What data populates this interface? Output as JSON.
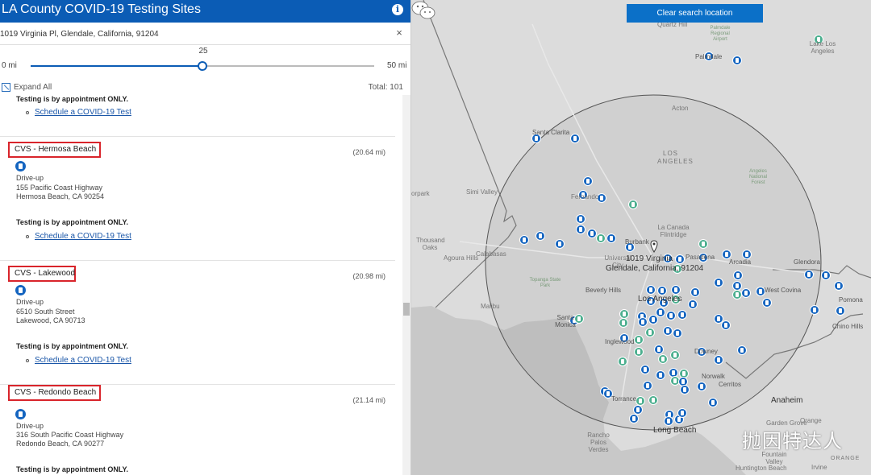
{
  "header": {
    "title": "LA County COVID-19 Testing Sites",
    "info_icon": "i"
  },
  "search": {
    "value": "1019 Virginia Pl, Glendale, California, 91204",
    "clear_icon": "×"
  },
  "radius_slider": {
    "value": "25",
    "min_label": "0 mi",
    "max_label": "50 mi",
    "fraction": 0.5
  },
  "list_controls": {
    "expand_label": "Expand All",
    "total_label": "Total: 101"
  },
  "results": {
    "top_fragment": {
      "note": "Testing is by appointment ONLY.",
      "link": "Schedule a COVID-19 Test"
    },
    "items": [
      {
        "name": "CVS - Hermosa Beach",
        "distance": "(20.64 mi)",
        "type": "Drive-up",
        "street": "155 Pacific Coast Highway",
        "city": "Hermosa Beach, CA 90254",
        "note": "Testing is by appointment ONLY.",
        "link": "Schedule a COVID-19 Test"
      },
      {
        "name": "CVS - Lakewood",
        "distance": "(20.98 mi)",
        "type": "Drive-up",
        "street": "6510 South Street",
        "city": "Lakewood, CA 90713",
        "note": "Testing is by appointment ONLY.",
        "link": "Schedule a COVID-19 Test"
      },
      {
        "name": "CVS - Redondo Beach",
        "distance": "(21.14 mi)",
        "type": "Drive-up",
        "street": "316 South Pacific Coast Highway",
        "city": "Redondo Beach, CA 90277",
        "note": "Testing is by appointment ONLY."
      }
    ]
  },
  "map": {
    "clear_button": "Clear search location",
    "search_address": [
      "1019 Virginia",
      "Glendale, California, 91204"
    ],
    "labels": {
      "quartz_hill": "Quartz Hill",
      "palmdale": "Palmdale",
      "lake_los_angeles": "Lake Los Angeles",
      "palmdale_airport": "Palmdale Regional Airport",
      "acton": "Acton",
      "santa_clarita": "Santa Clarita",
      "angeles": "ANGELES",
      "los": "LOS",
      "angeles_forest": "Angeles National Forest",
      "simi_valley": "Simi Valley",
      "moorpark": "orpark",
      "thousand_oaks": "Thousand Oaks",
      "agoura_hills": "Agoura Hills",
      "calabasas": "Calabasas",
      "la_canada": "La Canada Flintridge",
      "burbank": "Burbank",
      "universal_city": "Universal City",
      "pasadena": "Pasadena",
      "arcadia": "Arcadia",
      "glendora": "Glendora",
      "beverly_hills": "Beverly Hills",
      "los_angeles": "Los Angeles",
      "west_covina": "West Covina",
      "pomona": "Pomona",
      "malibu": "Malibu",
      "santa_monica": "Santa Monica",
      "chino_hills": "Chino Hills",
      "inglewood": "Inglewood",
      "downey": "Downey",
      "norwalk": "Norwalk",
      "cerritos": "Cerritos",
      "anaheim": "Anaheim",
      "torrance": "Torrance",
      "rancho": "Rancho Palos Verdes",
      "long_beach": "Long Beach",
      "garden_grove": "Garden Grove",
      "orange": "Orange",
      "fountain_valley": "Fountain Valley",
      "huntington_beach": "Huntington Beach",
      "irvine": "Irvine",
      "topanga": "Topanga State Park",
      "fernando": "Fernando",
      "santa_ana_mtns": "ORANGE"
    },
    "watermark": "抛因特达人",
    "colors": {
      "marker_blue": "#1565c0",
      "marker_green": "#4caf8f",
      "header_blue": "#0b5cb5",
      "highlight_red": "#d9242b"
    }
  }
}
